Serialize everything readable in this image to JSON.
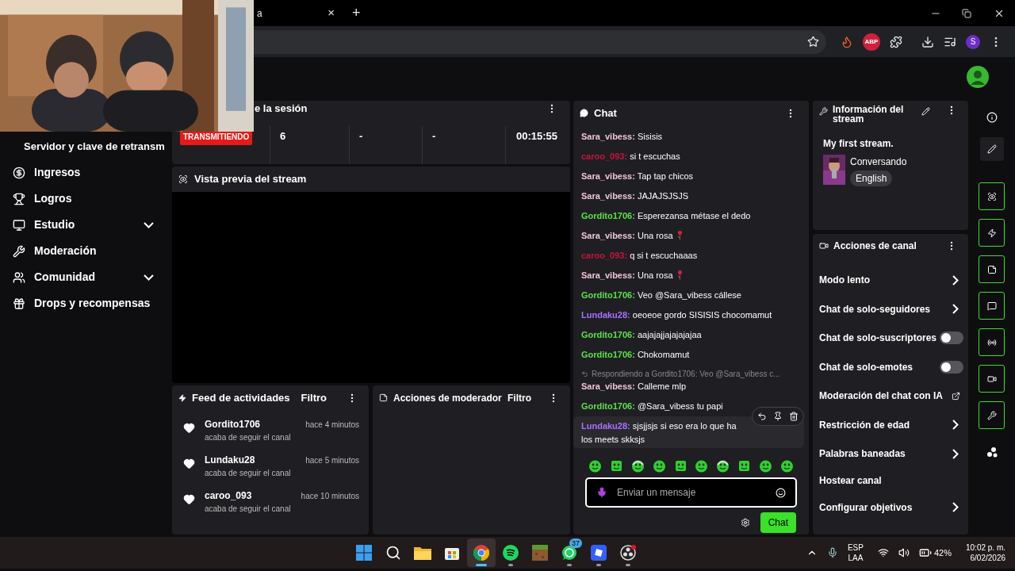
{
  "browser": {
    "tab_title": "a",
    "tab_close": "×",
    "new_tab": "+",
    "adblock_badge": "ABP",
    "profile_initial": "S"
  },
  "sidebar": {
    "partial_item": "Servidor y clave de retransm",
    "items": [
      {
        "label": "Ingresos",
        "kind": "money",
        "expandable": false
      },
      {
        "label": "Logros",
        "kind": "trophy",
        "expandable": false
      },
      {
        "label": "Estudio",
        "kind": "monitor",
        "expandable": true
      },
      {
        "label": "Moderación",
        "kind": "wrench",
        "expandable": false
      },
      {
        "label": "Comunidad",
        "kind": "users",
        "expandable": true
      },
      {
        "label": "Drops y recompensas",
        "kind": "gift",
        "expandable": false
      }
    ]
  },
  "session": {
    "title": "e la sesión",
    "status": "TRANSMITIENDO",
    "live": true,
    "stats": [
      "6",
      "-",
      "-",
      "00:15:55"
    ]
  },
  "preview": {
    "title": "Vista previa del stream"
  },
  "activity_feed": {
    "title": "Feed de actividades",
    "filter": "Filtro",
    "events": [
      {
        "name": "Gordito1706",
        "time": "hace 4 minutos",
        "action": "acaba de seguir el canal"
      },
      {
        "name": "Lundaku28",
        "time": "hace 5 minutos",
        "action": "acaba de seguir el canal"
      },
      {
        "name": "caroo_093",
        "time": "hace 10 minutos",
        "action": "acaba de seguir el canal"
      }
    ]
  },
  "mod_actions": {
    "title": "Acciones de moderador",
    "filter": "Filtro"
  },
  "chat": {
    "title": "Chat",
    "messages": [
      {
        "kind": "text",
        "user": "Sara_vibess:",
        "color": "#f0c4d2",
        "lines": [
          "Sisisis"
        ],
        "highlighted": false
      },
      {
        "kind": "text",
        "user": "caroo_093:",
        "color": "#c8143c",
        "lines": [
          "si t escuchas"
        ],
        "highlighted": false
      },
      {
        "kind": "text",
        "user": "Sara_vibess:",
        "color": "#f0c4d2",
        "lines": [
          "Tap tap chicos"
        ],
        "highlighted": false
      },
      {
        "kind": "text",
        "user": "Sara_vibess:",
        "color": "#f0c4d2",
        "lines": [
          "JAJAJSJSJS"
        ],
        "highlighted": false
      },
      {
        "kind": "text",
        "user": "Gordito1706:",
        "color": "#5ee04a",
        "lines": [
          "Esperezansa métase el dedo"
        ],
        "highlighted": false
      },
      {
        "kind": "emote",
        "user": "Sara_vibess:",
        "color": "#f0c4d2",
        "lines": [
          "Una rosa"
        ],
        "highlighted": false
      },
      {
        "kind": "text",
        "user": "caroo_093:",
        "color": "#c8143c",
        "lines": [
          "q si t escuchaaas"
        ],
        "highlighted": false
      },
      {
        "kind": "emote",
        "user": "Sara_vibess:",
        "color": "#f0c4d2",
        "lines": [
          "Una rosa"
        ],
        "highlighted": false
      },
      {
        "kind": "text",
        "user": "Gordito1706:",
        "color": "#5ee04a",
        "lines": [
          "Veo @Sara_vibess cállese"
        ],
        "highlighted": false
      },
      {
        "kind": "text",
        "user": "Lundaku28:",
        "color": "#a970ff",
        "lines": [
          "oeoeoe gordo SISISIS chocomamut"
        ],
        "highlighted": false
      },
      {
        "kind": "text",
        "user": "Gordito1706:",
        "color": "#5ee04a",
        "lines": [
          "aajajajjajajajajaa"
        ],
        "highlighted": false
      },
      {
        "kind": "text",
        "user": "Gordito1706:",
        "color": "#5ee04a",
        "lines": [
          "Chokomamut"
        ],
        "highlighted": false
      },
      {
        "kind": "text",
        "user": "Sara_vibess:",
        "color": "#f0c4d2",
        "reply_to": "Respondiendo a Gordito1706: Veo @Sara_vibess c...",
        "lines": [
          "Calleme mlp"
        ],
        "highlighted": false
      },
      {
        "kind": "text",
        "user": "Gordito1706:",
        "color": "#5ee04a",
        "lines": [
          "@Sara_vibess tu papi"
        ],
        "highlighted": false
      },
      {
        "kind": "text",
        "user": "Lundaku28:",
        "color": "#a970ff",
        "lines": [
          "sjsjjsjs si eso era lo que ha",
          "los meets skksjs"
        ],
        "highlighted": true
      }
    ],
    "placeholder": "Enviar un mensaje",
    "send": "Chat"
  },
  "stream_info": {
    "title": "Información del stream",
    "stream_title": "My first stream.",
    "category": "Conversando",
    "language": "English"
  },
  "channel_actions": {
    "title": "Acciones de canal",
    "items": [
      {
        "label": "Modo lento",
        "kind": "arrow"
      },
      {
        "label": "Chat de solo-seguidores",
        "kind": "arrow"
      },
      {
        "label": "Chat de solo-suscriptores",
        "kind": "toggle",
        "on": false
      },
      {
        "label": "Chat de solo-emotes",
        "kind": "toggle",
        "on": false
      },
      {
        "label": "Moderación del chat con IA",
        "kind": "external"
      },
      {
        "label": "Restricción de edad",
        "kind": "arrow"
      },
      {
        "label": "Palabras baneadas",
        "kind": "arrow"
      },
      {
        "label": "Hostear canal",
        "kind": "plain"
      },
      {
        "label": "Configurar objetivos",
        "kind": "arrow"
      }
    ]
  },
  "taskbar": {
    "apps": [
      {
        "kind": "windows",
        "running": false,
        "selected": false
      },
      {
        "kind": "search",
        "running": false,
        "selected": false
      },
      {
        "kind": "folder",
        "running": false,
        "selected": false
      },
      {
        "kind": "store",
        "running": false,
        "selected": false
      },
      {
        "kind": "chrome",
        "running": true,
        "selected": true
      },
      {
        "kind": "spotify",
        "running": true,
        "selected": false
      },
      {
        "kind": "minecraft",
        "running": false,
        "selected": false
      },
      {
        "kind": "whatsapp",
        "running": true,
        "selected": false,
        "badge": "37"
      },
      {
        "kind": "roblox",
        "running": true,
        "selected": false
      },
      {
        "kind": "obs",
        "running": true,
        "selected": false
      }
    ],
    "language": "ESP",
    "layout": "LAA",
    "battery": "42%",
    "time": "10:02 p. m.",
    "date": "6/02/2026"
  }
}
